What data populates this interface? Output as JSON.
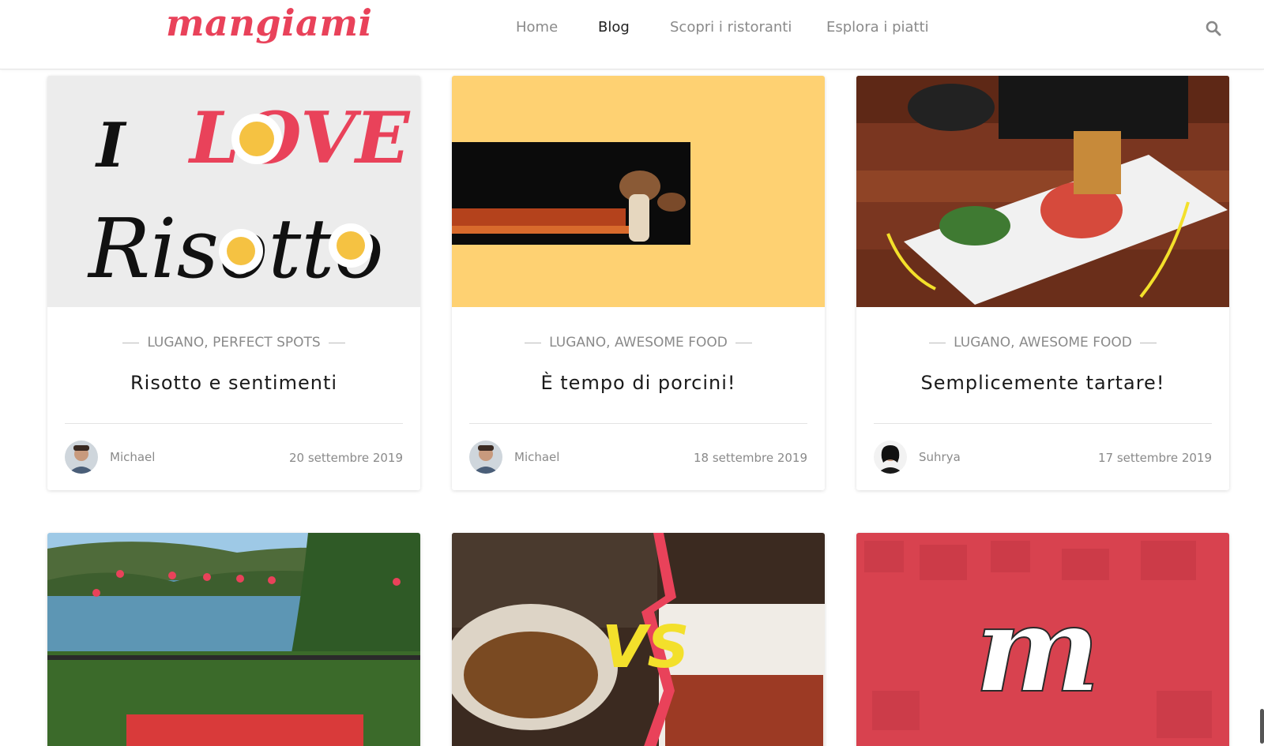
{
  "brand": {
    "name": "mangiami",
    "color": "#e9425a"
  },
  "nav": {
    "items": [
      {
        "label": "Home",
        "active": false
      },
      {
        "label": "Blog",
        "active": true
      },
      {
        "label": "Scopri i ristoranti",
        "active": false
      },
      {
        "label": "Esplora i piatti",
        "active": false
      }
    ],
    "search_icon": "search-icon"
  },
  "posts": [
    {
      "categories": [
        "LUGANO",
        "PERFECT SPOTS"
      ],
      "title": "Risotto e sentimenti",
      "author": "Michael",
      "date": "20 settembre 2019",
      "image_text": {
        "line1": "I",
        "line2": "LOVE",
        "line3": "Risotto"
      }
    },
    {
      "categories": [
        "LUGANO",
        "AWESOME FOOD"
      ],
      "title": "È tempo di porcini!",
      "author": "Michael",
      "date": "18 settembre 2019"
    },
    {
      "categories": [
        "LUGANO",
        "AWESOME FOOD"
      ],
      "title": "Semplicemente tartare!",
      "author": "Suhrya",
      "date": "17 settembre 2019"
    }
  ],
  "posts_row2": [
    {
      "image_text": ""
    },
    {
      "image_text": "VS"
    },
    {
      "image_text": "m"
    }
  ],
  "colors": {
    "accent": "#e9425a",
    "yellow_bg": "#fed172",
    "muted_text": "#8a8a8a"
  }
}
